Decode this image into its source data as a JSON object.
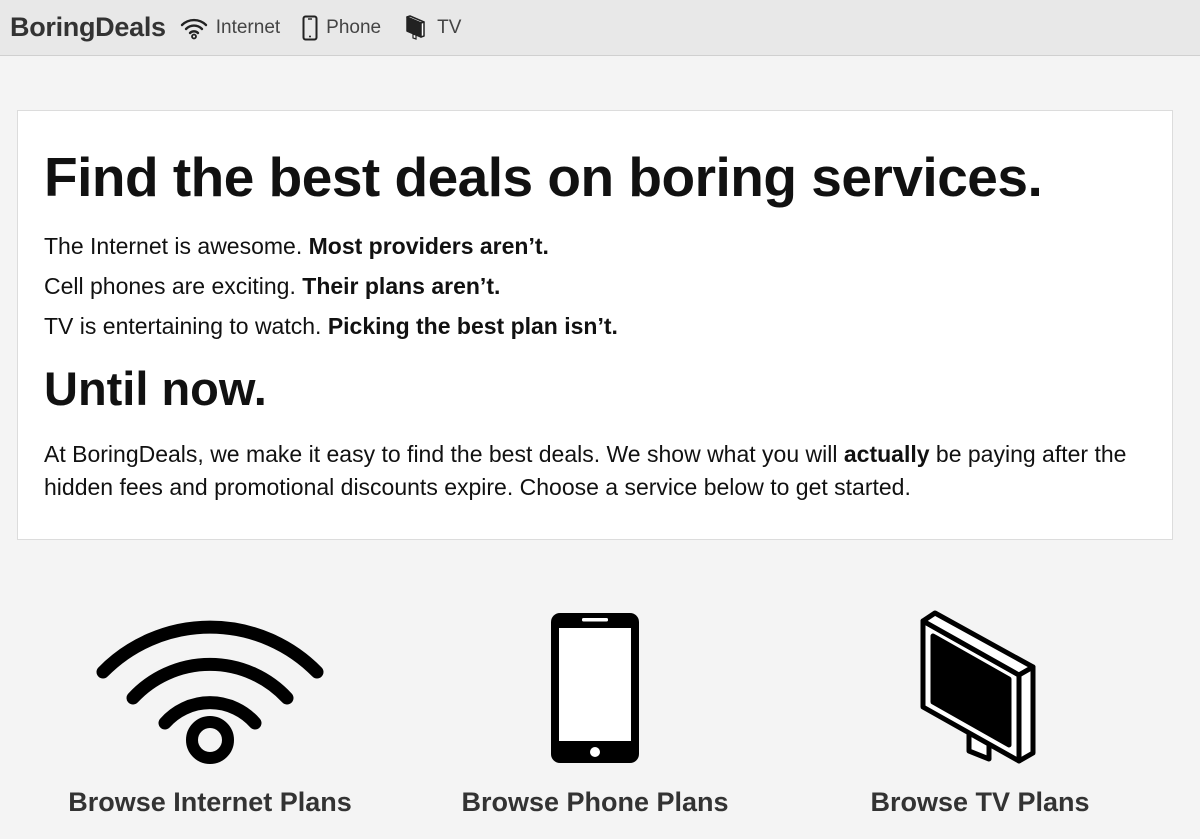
{
  "navbar": {
    "brand": "BoringDeals",
    "items": [
      {
        "label": "Internet",
        "icon": "wifi-icon"
      },
      {
        "label": "Phone",
        "icon": "phone-icon"
      },
      {
        "label": "TV",
        "icon": "tv-icon"
      }
    ]
  },
  "hero": {
    "title": "Find the best deals on boring services.",
    "lines": [
      {
        "plain": "The Internet is awesome. ",
        "bold": "Most providers aren’t."
      },
      {
        "plain": "Cell phones are exciting. ",
        "bold": "Their plans aren’t."
      },
      {
        "plain": "TV is entertaining to watch. ",
        "bold": "Picking the best plan isn’t."
      }
    ],
    "subtitle": "Until now.",
    "paragraph": {
      "before": "At BoringDeals, we make it easy to find the best deals. We show what you will ",
      "bold": "actually",
      "after": " be paying after the hidden fees and promotional discounts expire. Choose a service below to get started."
    }
  },
  "services": [
    {
      "label": "Browse Internet Plans",
      "icon": "wifi-icon"
    },
    {
      "label": "Browse Phone Plans",
      "icon": "phone-icon"
    },
    {
      "label": "Browse TV Plans",
      "icon": "tv-icon"
    }
  ]
}
